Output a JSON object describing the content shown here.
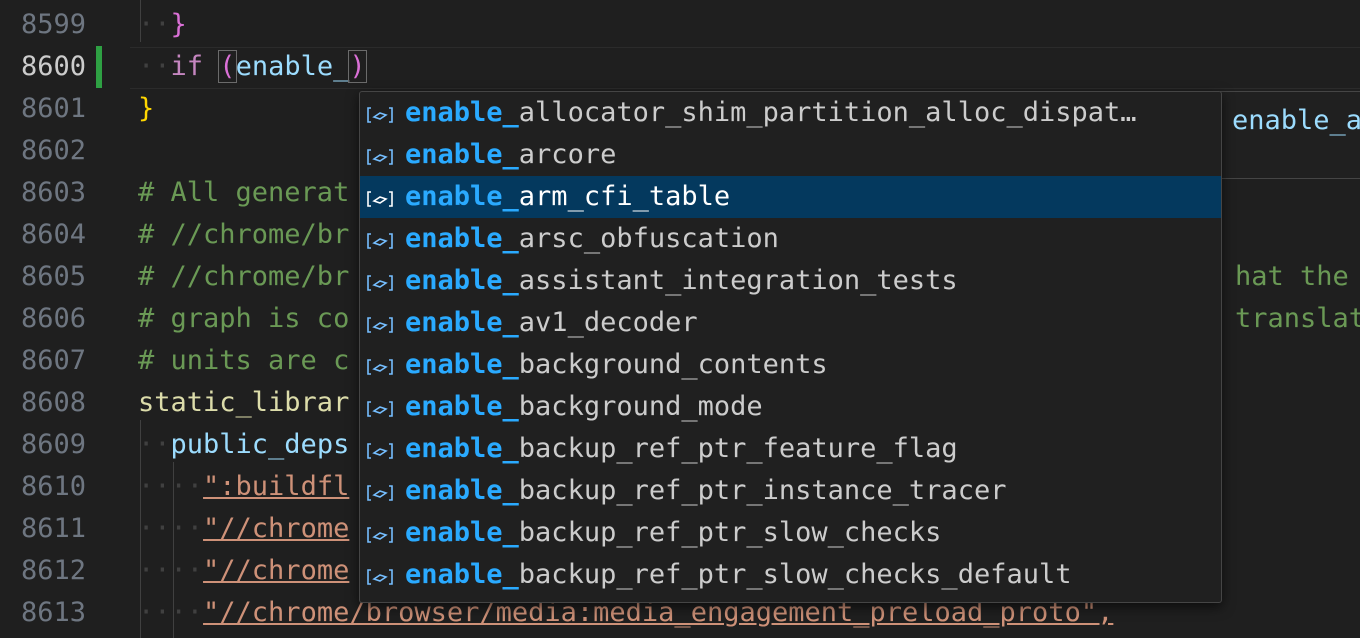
{
  "lines": [
    {
      "number": "8599",
      "code": "}"
    },
    {
      "number": "8600",
      "code": "if (enable_)"
    },
    {
      "number": "8601",
      "code": "}"
    },
    {
      "number": "8602",
      "code": ""
    },
    {
      "number": "8603",
      "code": "# All generat"
    },
    {
      "number": "8604",
      "code": "# //chrome/br"
    },
    {
      "number": "8605",
      "code": "# //chrome/br",
      "code_tail": "hat the b"
    },
    {
      "number": "8606",
      "code": "# graph is co",
      "code_tail": "translat"
    },
    {
      "number": "8607",
      "code": "# units are c"
    },
    {
      "number": "8608",
      "code": "static_librar"
    },
    {
      "number": "8609",
      "code": "public_deps"
    },
    {
      "number": "8610",
      "code": "\":buildfl"
    },
    {
      "number": "8611",
      "code": "\"//chrome"
    },
    {
      "number": "8612",
      "code": "\"//chrome"
    },
    {
      "number": "8613",
      "code": "\"//chrome/browser/media:media_engagement_preload_proto\","
    }
  ],
  "current_line": "8600",
  "suggest": {
    "match_prefix": "enable_",
    "selected_index": 2,
    "items": [
      {
        "suffix": "allocator_shim_partition_alloc_dispat…"
      },
      {
        "suffix": "arcore"
      },
      {
        "suffix": "arm_cfi_table"
      },
      {
        "suffix": "arsc_obfuscation"
      },
      {
        "suffix": "assistant_integration_tests"
      },
      {
        "suffix": "av1_decoder"
      },
      {
        "suffix": "background_contents"
      },
      {
        "suffix": "background_mode"
      },
      {
        "suffix": "backup_ref_ptr_feature_flag"
      },
      {
        "suffix": "backup_ref_ptr_instance_tracer"
      },
      {
        "suffix": "backup_ref_ptr_slow_checks"
      },
      {
        "suffix": "backup_ref_ptr_slow_checks_default"
      }
    ],
    "item_icon": "variable-icon",
    "details_text": "enable_a"
  },
  "colors": {
    "background": "#1f1f1f",
    "selection": "#04395e",
    "match": "#2aaaff",
    "comment": "#6a9955",
    "string": "#ce9178"
  }
}
